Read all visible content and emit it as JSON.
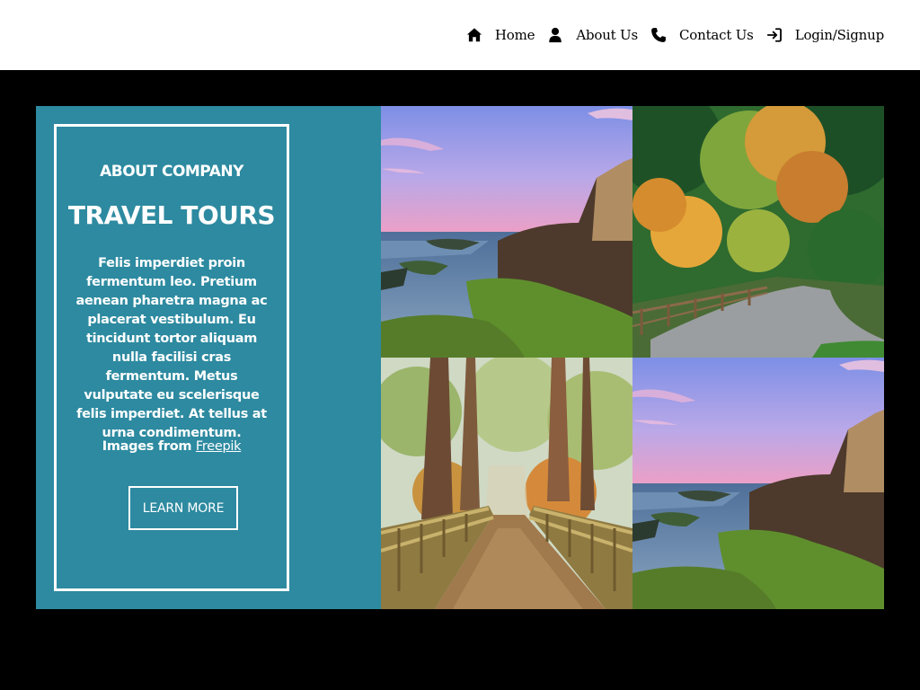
{
  "nav": {
    "items": [
      {
        "label": "Home",
        "icon": "home-icon"
      },
      {
        "label": "About Us",
        "icon": "user-icon"
      },
      {
        "label": "Contact Us",
        "icon": "phone-icon"
      },
      {
        "label": "Login/Signup",
        "icon": "login-icon"
      }
    ]
  },
  "about": {
    "subheading": "ABOUT COMPANY",
    "heading": "TRAVEL TOURS",
    "description": "Felis imperdiet proin fermentum leo. Pretium aenean pharetra magna ac placerat vestibulum. Eu tincidunt tortor aliquam nulla facilisi cras fermentum. Metus vulputate eu scelerisque felis imperdiet. At tellus at urna condimentum.",
    "credit_prefix": "Images from",
    "credit_link": "Freepik",
    "button_label": "LEARN MORE"
  },
  "colors": {
    "panel": "#2d8aa0",
    "background": "#000000",
    "nav_background": "#ffffff"
  }
}
